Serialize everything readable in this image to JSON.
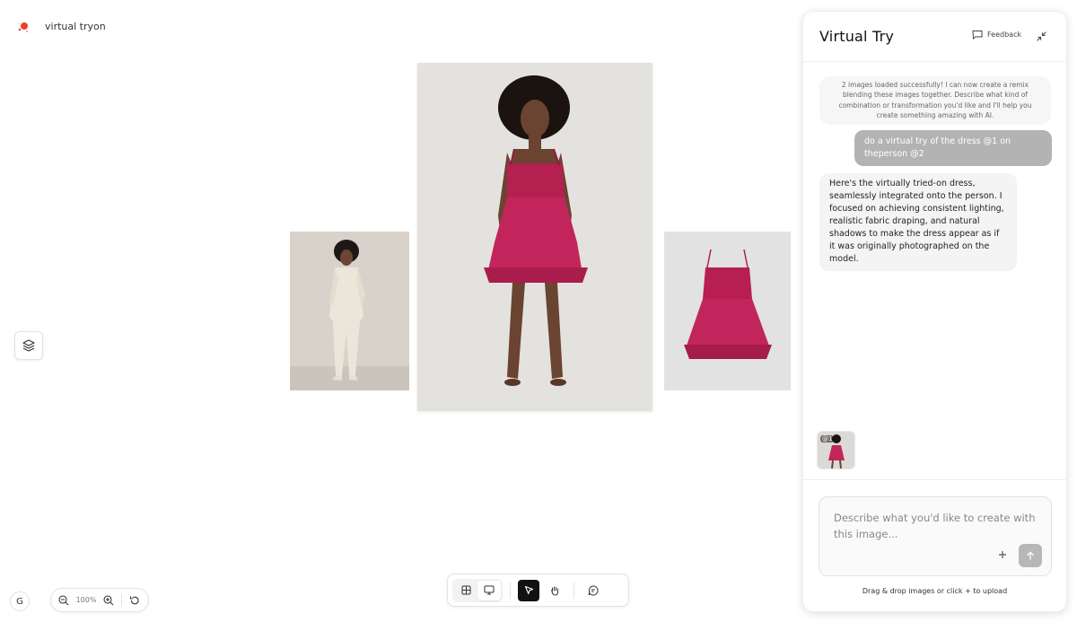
{
  "app": {
    "title": "virtual tryon"
  },
  "canvas": {
    "images": [
      {
        "name": "person photo"
      },
      {
        "name": "virtual try-on result"
      },
      {
        "name": "pink dress"
      }
    ]
  },
  "zoom": {
    "value": "100%",
    "g_label": "G"
  },
  "panel": {
    "title": "Virtual Try",
    "feedback_label": "Feedback",
    "messages": {
      "system": "2 images loaded successfully! I can now create a remix blending these images together. Describe what kind of combination or transformation you'd like and I'll help you create something amazing with AI.",
      "user": "do a virtual try of the dress @1 on theperson @2",
      "ai": "Here's the virtually tried-on dress, seamlessly integrated onto the person. I focused on achieving consistent lighting, realistic fabric draping, and natural shadows to make the dress appear as if it was originally photographed on the model."
    },
    "attachment_tag": "@1",
    "input": {
      "placeholder": "Describe what you'd like to create with this image..."
    },
    "upload_hint": "Drag & drop images or click + to upload"
  },
  "colors": {
    "dress": "#c2255c",
    "accent_dark": "#111111",
    "send_disabled": "#b7b7b7"
  }
}
